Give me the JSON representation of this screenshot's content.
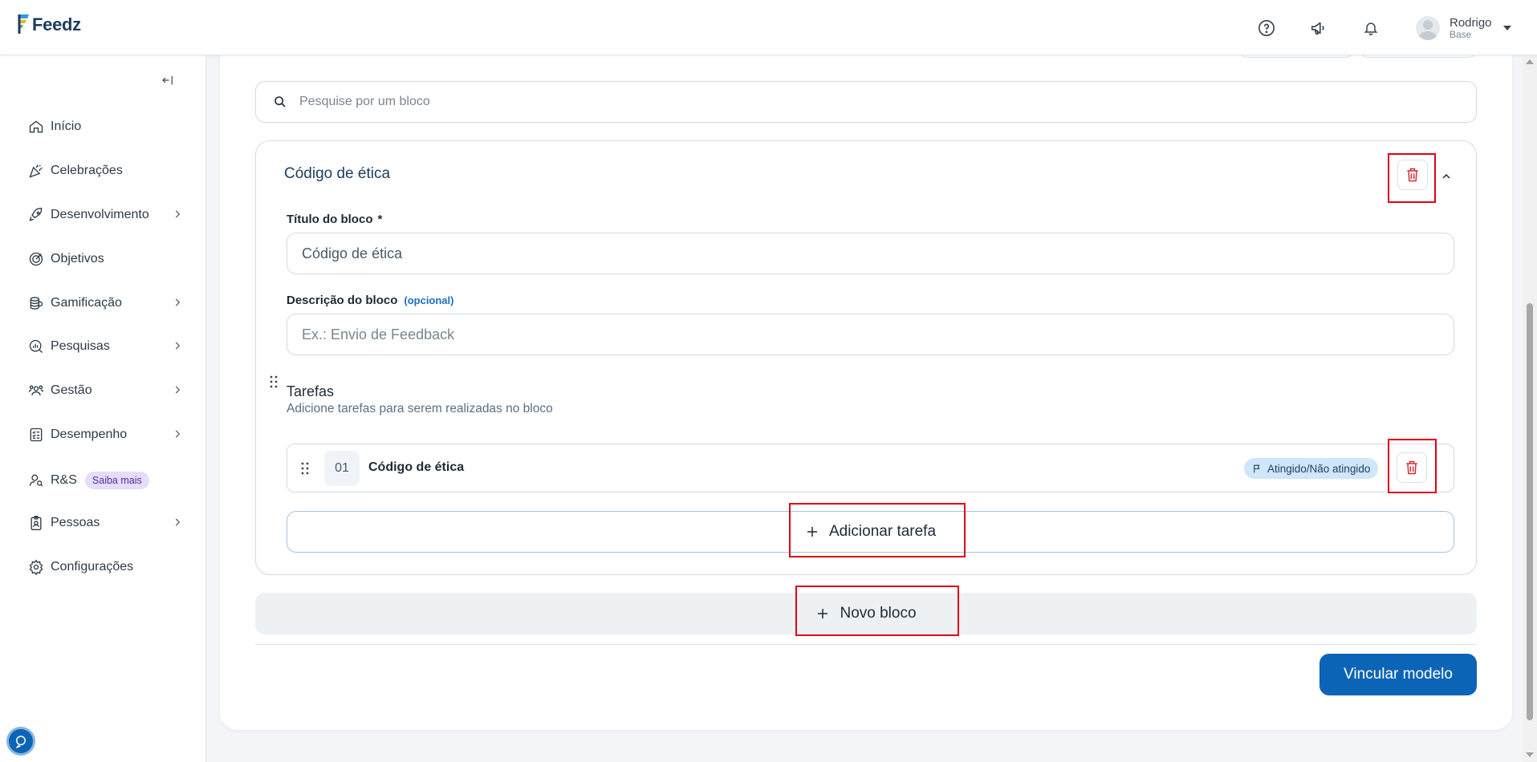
{
  "header": {
    "logo_text": "Feedz",
    "icons": [
      "help-circle-icon",
      "megaphone-icon",
      "bell-icon"
    ],
    "user": {
      "name": "Rodrigo",
      "subtitle": "Base"
    }
  },
  "sidebar": {
    "items": [
      {
        "label": "Início",
        "icon": "home-icon",
        "has_chevron": false
      },
      {
        "label": "Celebrações",
        "icon": "party-popper-icon",
        "has_chevron": false
      },
      {
        "label": "Desenvolvimento",
        "icon": "rocket-icon",
        "has_chevron": true
      },
      {
        "label": "Objetivos",
        "icon": "target-icon",
        "has_chevron": false
      },
      {
        "label": "Gamificação",
        "icon": "coins-icon",
        "has_chevron": true
      },
      {
        "label": "Pesquisas",
        "icon": "chart-search-icon",
        "has_chevron": true
      },
      {
        "label": "Gestão",
        "icon": "people-icon",
        "has_chevron": true
      },
      {
        "label": "Desempenho",
        "icon": "checklist-icon",
        "has_chevron": true
      },
      {
        "label": "R&S",
        "icon": "user-search-icon",
        "has_chevron": false,
        "badge": "Saiba mais"
      },
      {
        "label": "Pessoas",
        "icon": "id-badge-icon",
        "has_chevron": true
      },
      {
        "label": "Configurações",
        "icon": "gear-icon",
        "has_chevron": false
      }
    ]
  },
  "search": {
    "placeholder": "Pesquise por um bloco"
  },
  "block": {
    "title": "Código de ética",
    "title_field": {
      "label": "Título do bloco",
      "required_mark": "*",
      "value": "Código de ética"
    },
    "description_field": {
      "label": "Descrição do bloco",
      "optional_tag": "(opcional)",
      "placeholder": "Ex.: Envio de Feedback"
    },
    "tasks": {
      "title": "Tarefas",
      "subtitle": "Adicione tarefas para serem realizadas no bloco",
      "items": [
        {
          "number": "01",
          "name": "Código de ética",
          "badge": "Atingido/Não atingido"
        }
      ],
      "add_label": "Adicionar tarefa"
    }
  },
  "new_block_label": "Novo bloco",
  "primary_button": "Vincular modelo",
  "colors": {
    "accent": "#0c64b7",
    "delete_red": "#d32f2f",
    "highlight_red": "#e0001a",
    "badge_blue": "#cfe6fb"
  }
}
